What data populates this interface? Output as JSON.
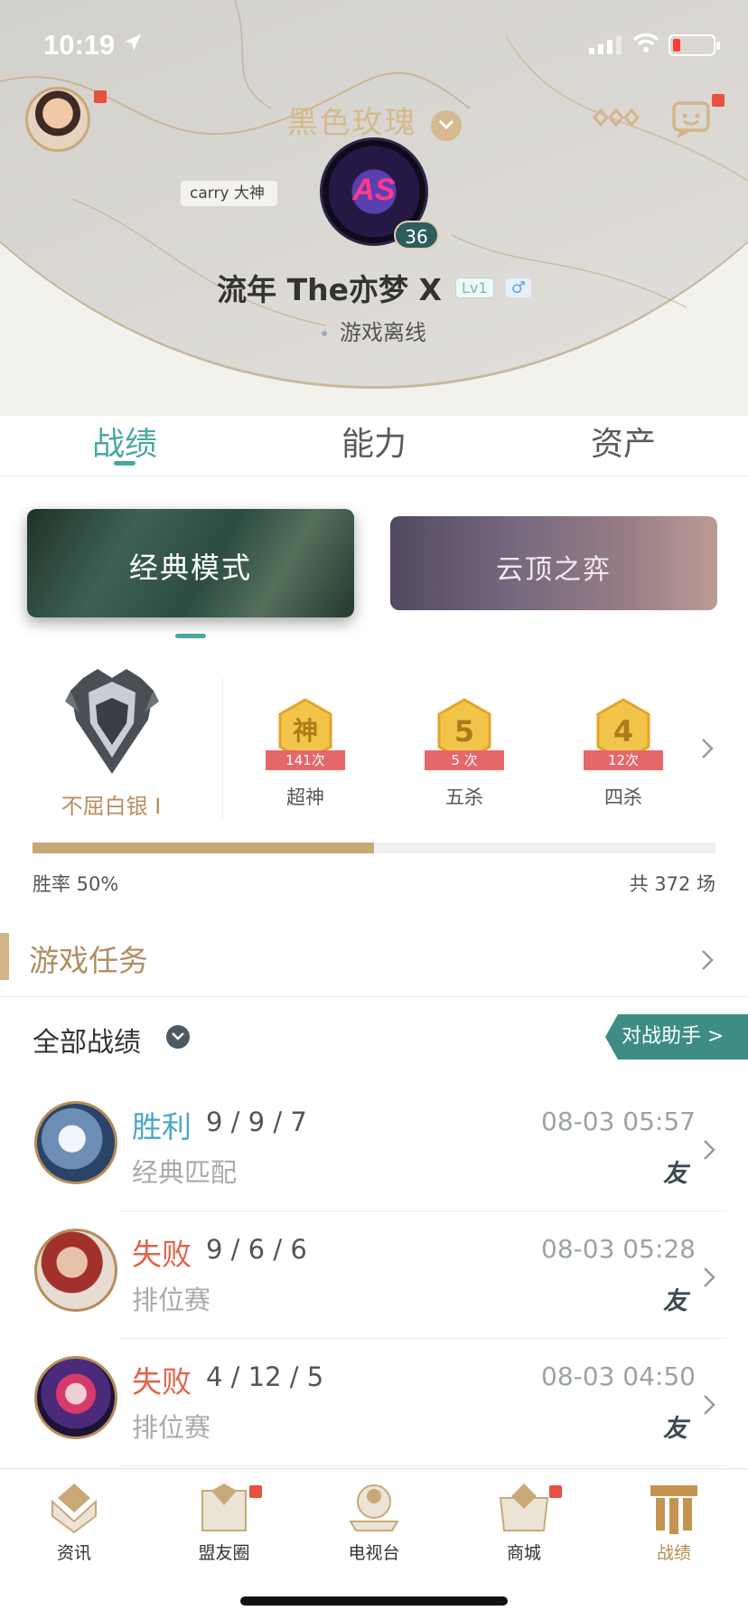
{
  "status_bar": {
    "time": "10:19"
  },
  "header": {
    "title": "黑色玫瑰",
    "carry_tag": "carry 大神",
    "level": "36",
    "player_name": "流年 The亦梦 X",
    "lv_tag": "Lv1",
    "gender": "♂",
    "online_status": "游戏离线",
    "emblem_text": "AS"
  },
  "tabs": [
    "战绩",
    "能力",
    "资产"
  ],
  "modes": {
    "classic": "经典模式",
    "tft": "云顶之弈"
  },
  "rank": {
    "name": "不屈白银 I"
  },
  "badges": [
    {
      "glyph": "神",
      "count": "141次",
      "label": "超神"
    },
    {
      "glyph": "5",
      "count": "5 次",
      "label": "五杀"
    },
    {
      "glyph": "4",
      "count": "12次",
      "label": "四杀"
    }
  ],
  "stats": {
    "winrate_text": "胜率 50%",
    "winrate": 0.5,
    "total_text": "共 372 场"
  },
  "tasks": {
    "label": "游戏任务"
  },
  "records": {
    "header": "全部战绩",
    "assist_button": "对战助手 >",
    "matches": [
      {
        "result": "胜利",
        "outcome": "win",
        "kda": "9 / 9 / 7",
        "mode": "经典匹配",
        "time": "08-03 05:57",
        "friend": "友"
      },
      {
        "result": "失败",
        "outcome": "lose",
        "kda": "9 / 6 / 6",
        "mode": "排位赛",
        "time": "08-03 05:28",
        "friend": "友"
      },
      {
        "result": "失败",
        "outcome": "lose",
        "kda": "4 / 12 / 5",
        "mode": "排位赛",
        "time": "08-03 04:50",
        "friend": "友"
      }
    ]
  },
  "bottom_nav": [
    {
      "label": "资讯",
      "icon": "news-icon"
    },
    {
      "label": "盟友圈",
      "icon": "friends-circle-icon"
    },
    {
      "label": "电视台",
      "icon": "tv-icon"
    },
    {
      "label": "商城",
      "icon": "shop-icon"
    },
    {
      "label": "战绩",
      "icon": "records-icon"
    }
  ],
  "colors": {
    "accent": "#4aa7a3",
    "gold": "#c9a878",
    "win": "#4aa7c8",
    "lose": "#e0644a",
    "badge_ribbon": "#e5676a"
  }
}
